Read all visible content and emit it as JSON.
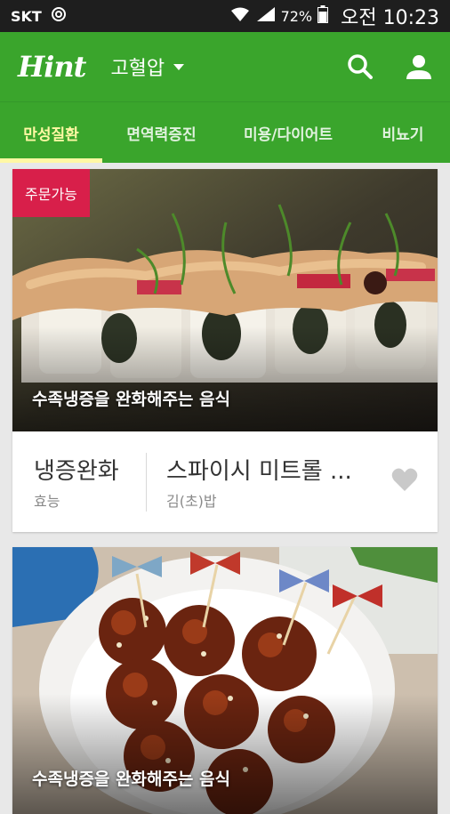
{
  "status_bar": {
    "carrier": "SKT",
    "battery": "72%",
    "time": "오전 10:23"
  },
  "app_bar": {
    "logo": "Hint",
    "condition": "고혈압"
  },
  "tabs": [
    {
      "label": "만성질환"
    },
    {
      "label": "면역력증진"
    },
    {
      "label": "미용/다이어트"
    },
    {
      "label": "비뇨기"
    }
  ],
  "cards": [
    {
      "badge": "주문가능",
      "caption": "수족냉증을 완화해주는 음식",
      "effect": "냉증완화",
      "effect_label": "효능",
      "name": "스파이시 미트롤 ...",
      "category": "김(초)밥"
    },
    {
      "caption": "수족냉증을 완화해주는 음식"
    }
  ],
  "colors": {
    "brand_green": "#3aa52c",
    "active_tab": "#fff8a4",
    "badge": "#d81f4a"
  },
  "icons": {
    "search": "search-icon",
    "account": "account-icon",
    "favorite": "heart-icon"
  }
}
